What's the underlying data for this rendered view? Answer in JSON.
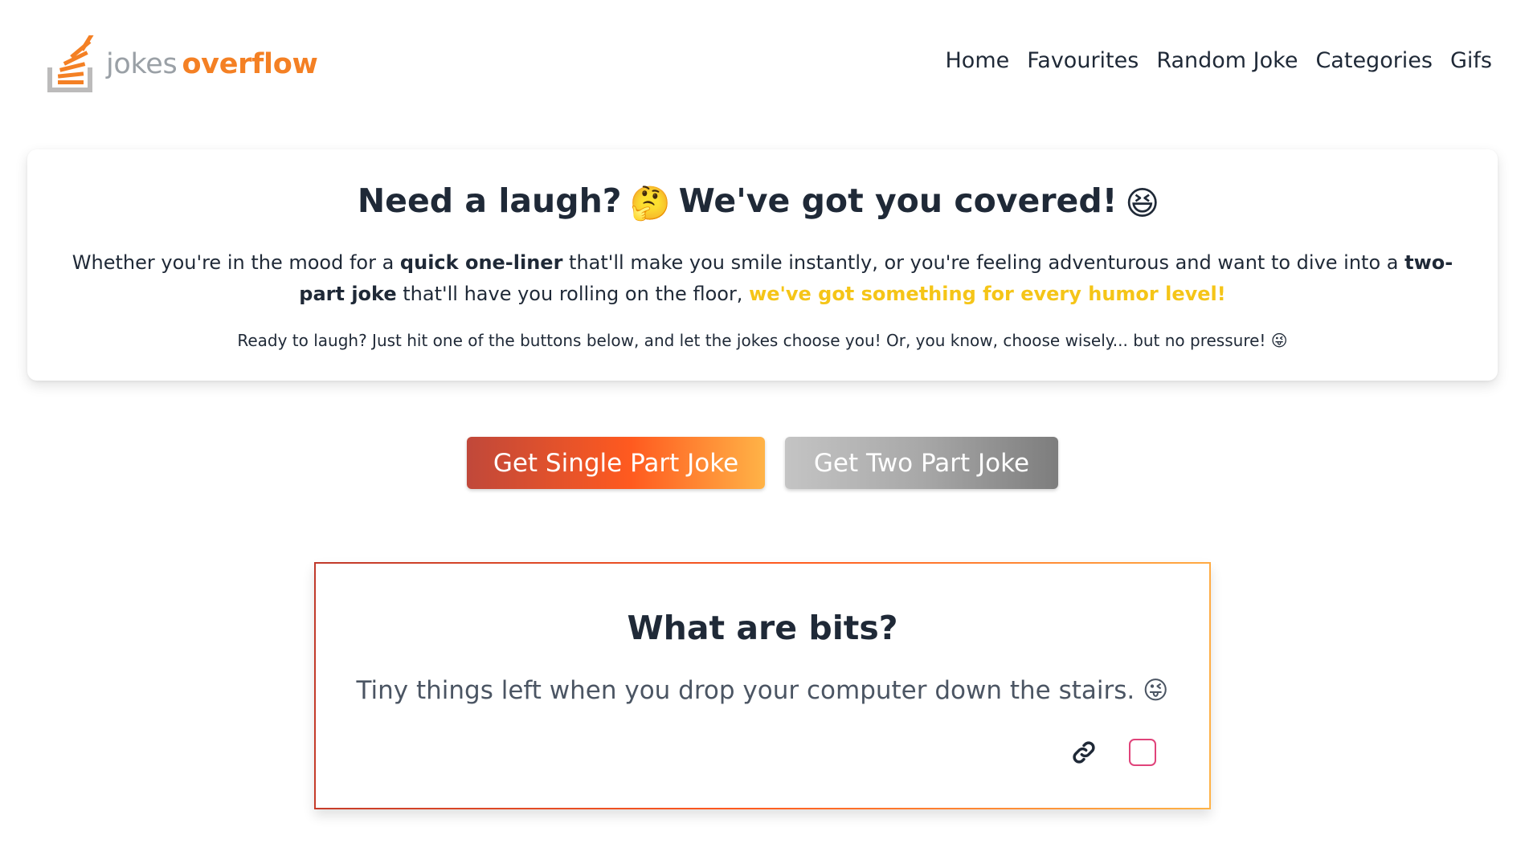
{
  "header": {
    "logo": {
      "word_1": "jokes",
      "word_2": "overflow",
      "icon": "stacked-tray-icon",
      "colors": {
        "grey": "#9aa0a6",
        "orange": "#f48024"
      }
    },
    "nav": [
      {
        "label": "Home"
      },
      {
        "label": "Favourites"
      },
      {
        "label": "Random Joke"
      },
      {
        "label": "Categories"
      },
      {
        "label": "Gifs"
      }
    ]
  },
  "intro": {
    "title_part_1": "Need a laugh?",
    "title_emoji_1": "🤔",
    "title_part_2": "We've got you covered!",
    "title_emoji_2": "😆",
    "body_part_1": "Whether you're in the mood for a ",
    "body_bold_1": "quick one-liner",
    "body_part_2": " that'll make you smile instantly, or you're feeling adventurous and want to dive into a ",
    "body_bold_2": "two-part joke",
    "body_part_3": " that'll have you rolling on the floor, ",
    "body_highlight": "we've got something for every humor level!",
    "small_text": "Ready to laugh? Just hit one of the buttons below, and let the jokes choose you! Or, you know, choose wisely... but no pressure!",
    "small_emoji": "😜",
    "highlight_color": "#f5c518"
  },
  "buttons": {
    "single": "Get Single Part Joke",
    "two": "Get Two Part Joke"
  },
  "joke": {
    "title": "What are bits?",
    "text": "Tiny things left when you drop your computer down the stairs.",
    "emoji": "😜",
    "favourite_checked": false,
    "icons": {
      "link": "link-icon",
      "favourite": "favourite-checkbox"
    },
    "border_colors": [
      "#c0392b",
      "#ff5a1f",
      "#ffb347"
    ]
  }
}
